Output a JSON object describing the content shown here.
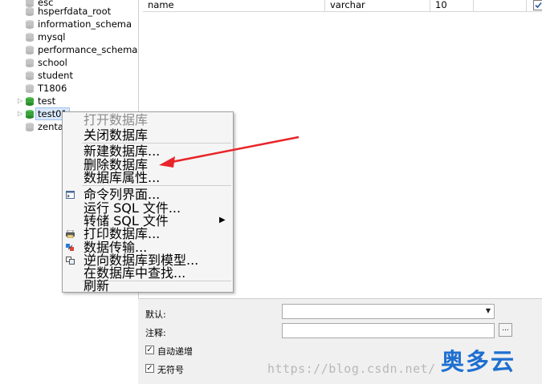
{
  "tree": {
    "items": [
      {
        "label": "esc",
        "expandable": false
      },
      {
        "label": "hsperfdata_root",
        "expandable": false
      },
      {
        "label": "information_schema",
        "expandable": false
      },
      {
        "label": "mysql",
        "expandable": false
      },
      {
        "label": "performance_schema",
        "expandable": false
      },
      {
        "label": "school",
        "expandable": false
      },
      {
        "label": "student",
        "expandable": false
      },
      {
        "label": "T1806",
        "expandable": false
      },
      {
        "label": "test",
        "expandable": true,
        "open": true
      },
      {
        "label": "test01",
        "expandable": true,
        "open": true,
        "selected": true
      },
      {
        "label": "zentao",
        "expandable": false
      }
    ]
  },
  "grid": {
    "row": {
      "name": "name",
      "type": "varchar",
      "length": "10",
      "checked": true
    }
  },
  "context_menu": {
    "items": [
      {
        "label": "打开数据库",
        "disabled": true
      },
      {
        "label": "关闭数据库"
      },
      {
        "label": "新建数据库..."
      },
      {
        "label": "删除数据库"
      },
      {
        "label": "数据库属性..."
      },
      {
        "label": "命令列界面...",
        "icon": "console-icon"
      },
      {
        "label": "运行 SQL 文件..."
      },
      {
        "label": "转储 SQL 文件",
        "submenu": true
      },
      {
        "label": "打印数据库...",
        "icon": "printer-icon"
      },
      {
        "label": "数据传输...",
        "icon": "data-transfer-icon"
      },
      {
        "label": "逆向数据库到模型...",
        "icon": "reverse-model-icon"
      },
      {
        "label": "在数据库中查找..."
      },
      {
        "label": "刷新"
      }
    ]
  },
  "properties": {
    "default_label": "默认:",
    "comment_label": "注释:",
    "ellipsis": "...",
    "auto_increment_label": "自动递增",
    "auto_increment_checked": true,
    "unsigned_label": "无符号",
    "unsigned_checked": true
  },
  "watermark": {
    "url": "https://blog.csdn.net/",
    "logo": "奥多云"
  },
  "colors": {
    "annotation_arrow": "#e8252a",
    "selection": "#d9e8fb",
    "db_icon_green": "#3aa53a",
    "logo_blue": "#1e6fd0"
  }
}
